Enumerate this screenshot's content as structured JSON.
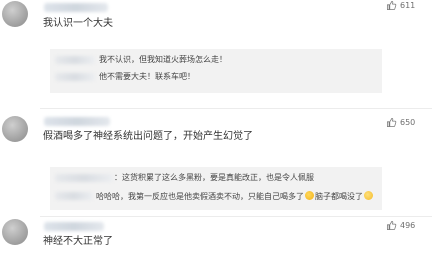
{
  "comments": [
    {
      "text": "我认识一个大夫",
      "likes": "611",
      "replies": [
        {
          "text": "我不认识，但我知道火葬场怎么走！"
        },
        {
          "text": "他不需要大夫！联系车吧！"
        }
      ]
    },
    {
      "text": "假酒喝多了神经系统出问题了，开始产生幻觉了",
      "likes": "650",
      "replies": [
        {
          "text": "：这货积累了这么多黑粉，要是真能改正，也是令人佩服"
        },
        {
          "text_a": "哈哈哈，我第一反应也是他卖假酒卖不动，只能自己喝多了",
          "emoji_a": "smirk",
          "text_b": "脑子都喝没了",
          "emoji_b": "drool"
        }
      ]
    },
    {
      "text": "神经不大正常了",
      "likes": "496"
    }
  ],
  "icons": {
    "like": "thumbs-up-icon"
  }
}
